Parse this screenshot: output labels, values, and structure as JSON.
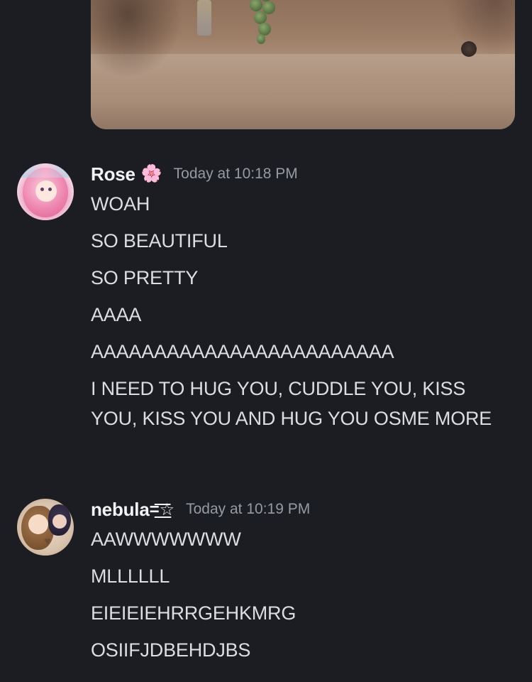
{
  "messages": [
    {
      "username": "Rose",
      "badge": "🌸",
      "timestamp": "Today at 10:18 PM",
      "lines": [
        "WOAH",
        "SO BEAUTIFUL",
        "SO PRETTY",
        "AAAA",
        "AAAAAAAAAAAAAAAAAAAAAAAA",
        "I NEED TO HUG YOU, CUDDLE YOU, KISS YOU, KISS YOU AND HUG YOU OSME MORE"
      ]
    },
    {
      "username": "nebula",
      "badge": "=͟͟͞͞☆",
      "timestamp": "Today at 10:19 PM",
      "lines": [
        "AAWWWWWWW",
        "MLLLLLL",
        "EIEIEIEHRRGEHKMRG",
        "OSIIFJDBEHDJBS"
      ]
    }
  ],
  "colors": {
    "background": "#1c1d22",
    "text": "#dbdee1",
    "username": "#f2f3f5",
    "timestamp": "#949ba4"
  }
}
